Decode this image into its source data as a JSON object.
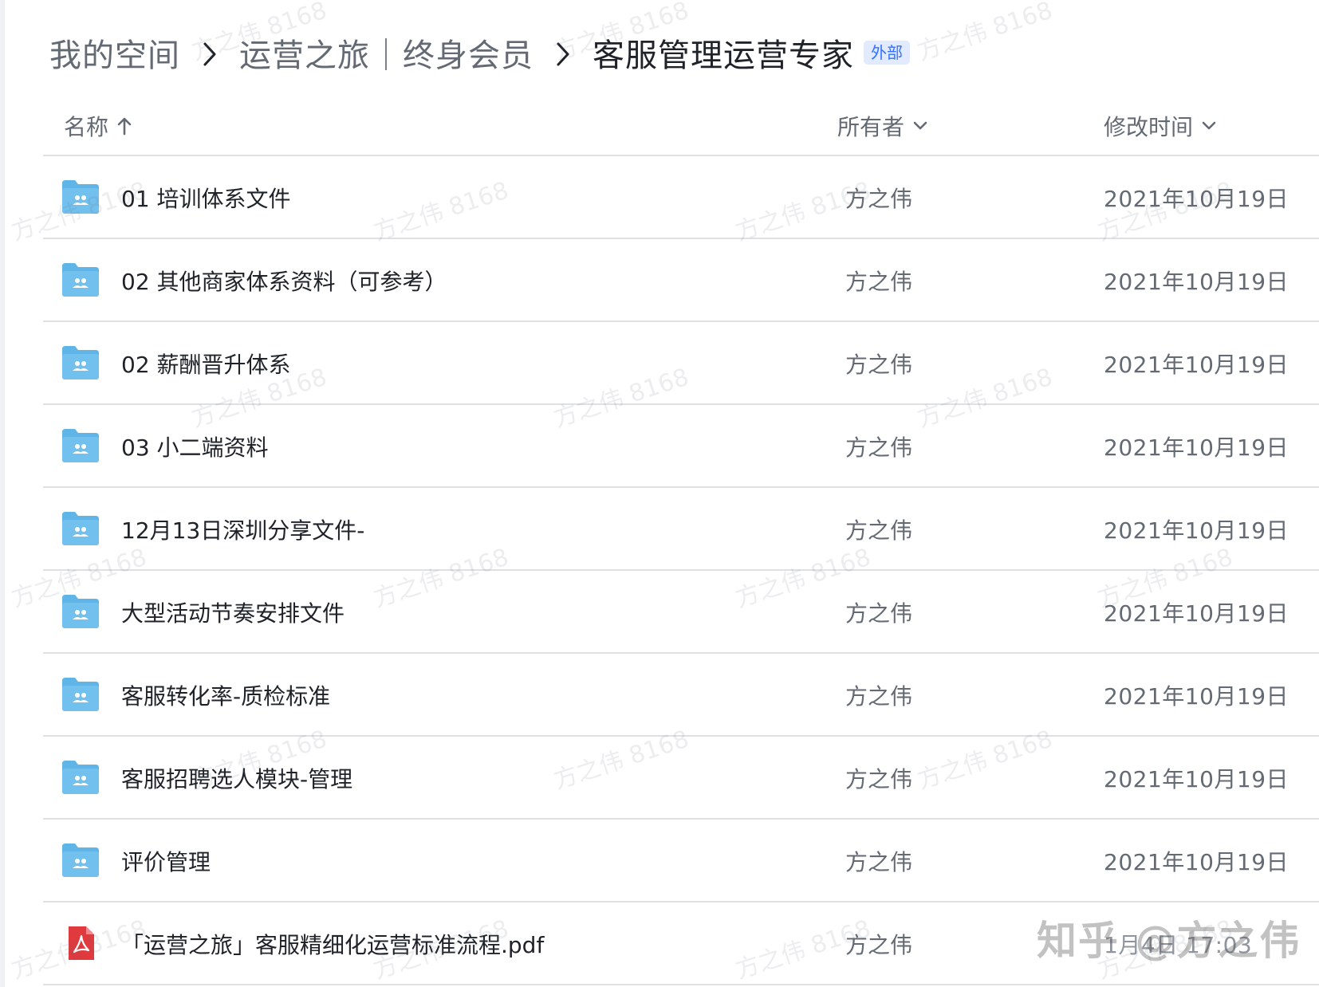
{
  "breadcrumb": {
    "items": [
      "我的空间",
      "运营之旅｜终身会员",
      "客服管理运营专家"
    ],
    "tag": "外部"
  },
  "table": {
    "columns": {
      "name": "名称",
      "owner": "所有者",
      "time": "修改时间"
    },
    "rows": [
      {
        "type": "folder",
        "name": "01 培训体系文件",
        "owner": "方之伟",
        "time": "2021年10月19日"
      },
      {
        "type": "folder",
        "name": "02 其他商家体系资料（可参考）",
        "owner": "方之伟",
        "time": "2021年10月19日"
      },
      {
        "type": "folder",
        "name": "02 薪酬晋升体系",
        "owner": "方之伟",
        "time": "2021年10月19日"
      },
      {
        "type": "folder",
        "name": "03 小二端资料",
        "owner": "方之伟",
        "time": "2021年10月19日"
      },
      {
        "type": "folder",
        "name": "12月13日深圳分享文件-",
        "owner": "方之伟",
        "time": "2021年10月19日"
      },
      {
        "type": "folder",
        "name": "大型活动节奏安排文件",
        "owner": "方之伟",
        "time": "2021年10月19日"
      },
      {
        "type": "folder",
        "name": "客服转化率-质检标准",
        "owner": "方之伟",
        "time": "2021年10月19日"
      },
      {
        "type": "folder",
        "name": "客服招聘选人模块-管理",
        "owner": "方之伟",
        "time": "2021年10月19日"
      },
      {
        "type": "folder",
        "name": "评价管理",
        "owner": "方之伟",
        "time": "2021年10月19日"
      },
      {
        "type": "pdf",
        "name": "「运营之旅」客服精细化运营标准流程.pdf",
        "owner": "方之伟",
        "time": "1月4日 17:03"
      }
    ]
  },
  "watermark": "方之伟 8168",
  "zhihu_watermark": "知乎 @方之伟",
  "colors": {
    "folder": "#5fb4e8",
    "pdf": "#e0393e",
    "tag_bg": "#e1eaff",
    "tag_text": "#3370ff",
    "divider": "#dee0e3"
  },
  "icons": {
    "sort_name": "arrow-up-icon",
    "sort_owner": "chevron-down-icon",
    "sort_time": "chevron-down-icon",
    "breadcrumb_separator": "chevron-right-icon",
    "folder": "shared-folder-icon",
    "pdf": "pdf-file-icon"
  }
}
